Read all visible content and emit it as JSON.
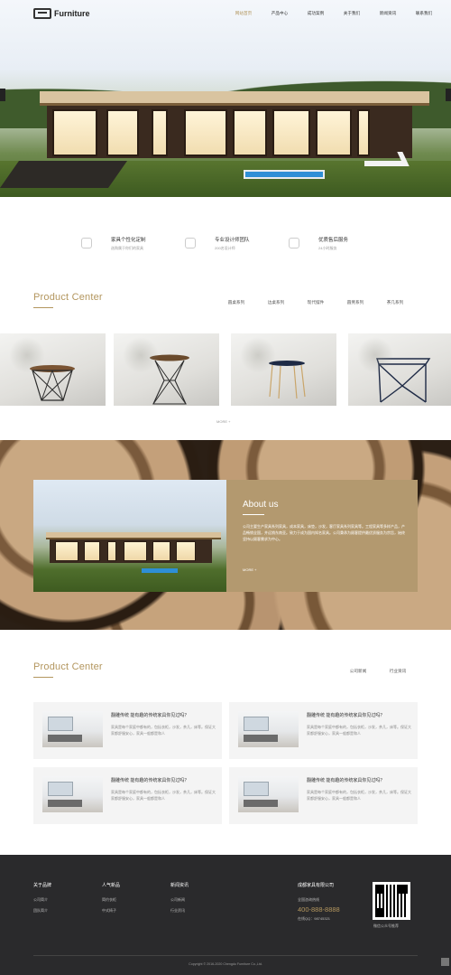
{
  "header": {
    "logo_text": "Furniture",
    "nav": [
      "网站首页",
      "产品中心",
      "成功案例",
      "关于我们",
      "新闻资讯",
      "联系我们"
    ],
    "active_index": 0
  },
  "features": [
    {
      "title": "家具个性化定制",
      "sub": "选购属于你们的家具"
    },
    {
      "title": "专业设计师团队",
      "sub": "200名设计师"
    },
    {
      "title": "优质售后服务",
      "sub": "24小时服务"
    }
  ],
  "product_center": {
    "title": "Product Center",
    "tabs": [
      "圆桌系列",
      "边桌系列",
      "现代摆件",
      "圆凳系列",
      "茶几系列"
    ],
    "more": "MORE +"
  },
  "about": {
    "title": "About us",
    "text": "公司主要生产家具系列家具，成本家具，床垫，沙发，客厅家具系列家具等。工程家具等多样产品，产品畅销全国，并远销东南亚。致力于成为国内知名家具。公司秉承为顾客提供最优质服务为宗旨，始终坚持以顾客需求为中心。",
    "more": "MORE +"
  },
  "news_section": {
    "title": "Product Center",
    "tabs": [
      "公司新闻",
      "行业资讯"
    ],
    "items": [
      {
        "title": "翻雕传统 能有趣的传统家具你见过吗？",
        "desc": "家具是每个家庭中都有的，包括衣柜，沙发，茶几，床等。保证大家都舒服安心，家具一般都是和人"
      },
      {
        "title": "翻雕传统 能有趣的传统家具你见过吗？",
        "desc": "家具是每个家庭中都有的，包括衣柜，沙发，茶几，床等。保证大家都舒服安心，家具一般都是和人"
      },
      {
        "title": "翻雕传统 能有趣的传统家具你见过吗？",
        "desc": "家具是每个家庭中都有的，包括衣柜，沙发，茶几，床等。保证大家都舒服安心，家具一般都是和人"
      },
      {
        "title": "翻雕传统 能有趣的传统家具你见过吗？",
        "desc": "家具是每个家庭中都有的，包括衣柜，沙发，茶几，床等。保证大家都舒服安心，家具一般都是和人"
      }
    ]
  },
  "footer": {
    "col1": {
      "heading": "关于品牌",
      "links": [
        "公司简介",
        "团队简介"
      ]
    },
    "col2": {
      "heading": "人气新品",
      "links": [
        "简约衣柜",
        "中式椅子"
      ]
    },
    "col3": {
      "heading": "新闻资讯",
      "links": [
        "公司新闻",
        "行业资讯"
      ]
    },
    "company": {
      "name": "成都家具有限公司",
      "hotline_label": "全国咨询热线",
      "phone": "400-888-8888",
      "qq": "在线QQ：98745321"
    },
    "qr_caption": "微信公众号推荐",
    "copyright": "Copyright © 2016-2020 Chengdu Furniture Co.,Ltd."
  },
  "colors": {
    "accent": "#b3965e",
    "footer_bg": "#2a2a2c",
    "about_panel": "#b3996f"
  }
}
